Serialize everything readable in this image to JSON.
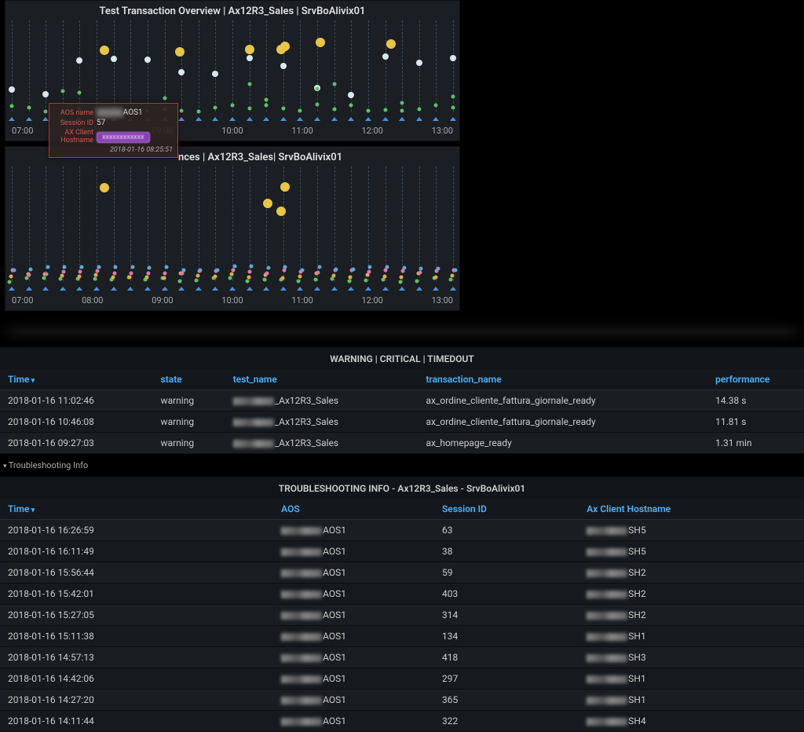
{
  "charts": {
    "top": {
      "title": "Test Transaction Overview | Ax12R3_Sales | SrvBoAlivix01",
      "x_ticks": [
        "07:00",
        "08:00",
        "09:00",
        "10:00",
        "11:00",
        "12:00",
        "13:00"
      ]
    },
    "bottom": {
      "title_suffix": "nces | Ax12R3_Sales| SrvBoAlivix01",
      "x_ticks": [
        "07:00",
        "08:00",
        "09:00",
        "10:00",
        "11:00",
        "12:00",
        "13:00"
      ]
    }
  },
  "tooltip": {
    "rows": [
      {
        "label": "AOS name",
        "value": "AOS1",
        "blur_prefix": true
      },
      {
        "label": "Session ID",
        "value": "57"
      },
      {
        "label": "AX Client Hostname",
        "pill": true
      }
    ],
    "timestamp": "2018-01-16 08:25:51"
  },
  "warning_table": {
    "title": "WARNING | CRITICAL | TIMEDOUT",
    "headers": {
      "time": "Time",
      "state": "state",
      "test": "test_name",
      "txn": "transaction_name",
      "perf": "performance"
    },
    "rows": [
      {
        "time": "2018-01-16 11:02:46",
        "state": "warning",
        "test": "_Ax12R3_Sales",
        "txn": "ax_ordine_cliente_fattura_giornale_ready",
        "perf": "14.38 s"
      },
      {
        "time": "2018-01-16 10:46:08",
        "state": "warning",
        "test": "_Ax12R3_Sales",
        "txn": "ax_ordine_cliente_fattura_giornale_ready",
        "perf": "11.81 s"
      },
      {
        "time": "2018-01-16 09:27:03",
        "state": "warning",
        "test": "_Ax12R3_Sales",
        "txn": "ax_homepage_ready",
        "perf": "1.31 min"
      }
    ]
  },
  "expander_label": "Troubleshooting Info",
  "troubleshoot_table": {
    "title": "TROUBLESHOOTING INFO - Ax12R3_Sales - SrvBoAlivix01",
    "headers": {
      "time": "Time",
      "aos": "AOS",
      "sid": "Session ID",
      "host": "Ax Client Hostname"
    },
    "rows": [
      {
        "time": "2018-01-16 16:26:59",
        "aos": "AOS1",
        "sid": "63",
        "host": "SH5"
      },
      {
        "time": "2018-01-16 16:11:49",
        "aos": "AOS1",
        "sid": "38",
        "host": "SH5"
      },
      {
        "time": "2018-01-16 15:56:44",
        "aos": "AOS1",
        "sid": "59",
        "host": "SH2"
      },
      {
        "time": "2018-01-16 15:42:01",
        "aos": "AOS1",
        "sid": "403",
        "host": "SH2"
      },
      {
        "time": "2018-01-16 15:27:05",
        "aos": "AOS1",
        "sid": "314",
        "host": "SH2"
      },
      {
        "time": "2018-01-16 15:11:38",
        "aos": "AOS1",
        "sid": "134",
        "host": "SH1"
      },
      {
        "time": "2018-01-16 14:57:13",
        "aos": "AOS1",
        "sid": "418",
        "host": "SH3"
      },
      {
        "time": "2018-01-16 14:42:06",
        "aos": "AOS1",
        "sid": "297",
        "host": "SH1"
      },
      {
        "time": "2018-01-16 14:27:20",
        "aos": "AOS1",
        "sid": "365",
        "host": "SH1"
      },
      {
        "time": "2018-01-16 14:11:44",
        "aos": "AOS1",
        "sid": "322",
        "host": "SH4"
      }
    ]
  },
  "chart_data": [
    {
      "type": "scatter",
      "title": "Test Transaction Overview | Ax12R3_Sales | SrvBoAlivix01",
      "x_range_hours": [
        7,
        13.5
      ],
      "note": "Each vertical dashed line ~15min interval; dots represent transaction events. Large amber dots = warning/critical events at approx 08:25, 09:30, 10:30, 11:00x2, 11:40, 12:40. White mid dots cluster around tick marks at varying heights. Small green dots baseline near every tick."
    },
    {
      "type": "scatter",
      "title": "... nces | Ax12R3_Sales| SrvBoAlivix01",
      "x_range_hours": [
        7,
        13.5
      ],
      "note": "Similar 15-min grid. Large amber dots at approx 08:25, 10:45, 11:00x2. Small multi-color dots (green/orange/pink/blue) at baseline per tick."
    }
  ]
}
